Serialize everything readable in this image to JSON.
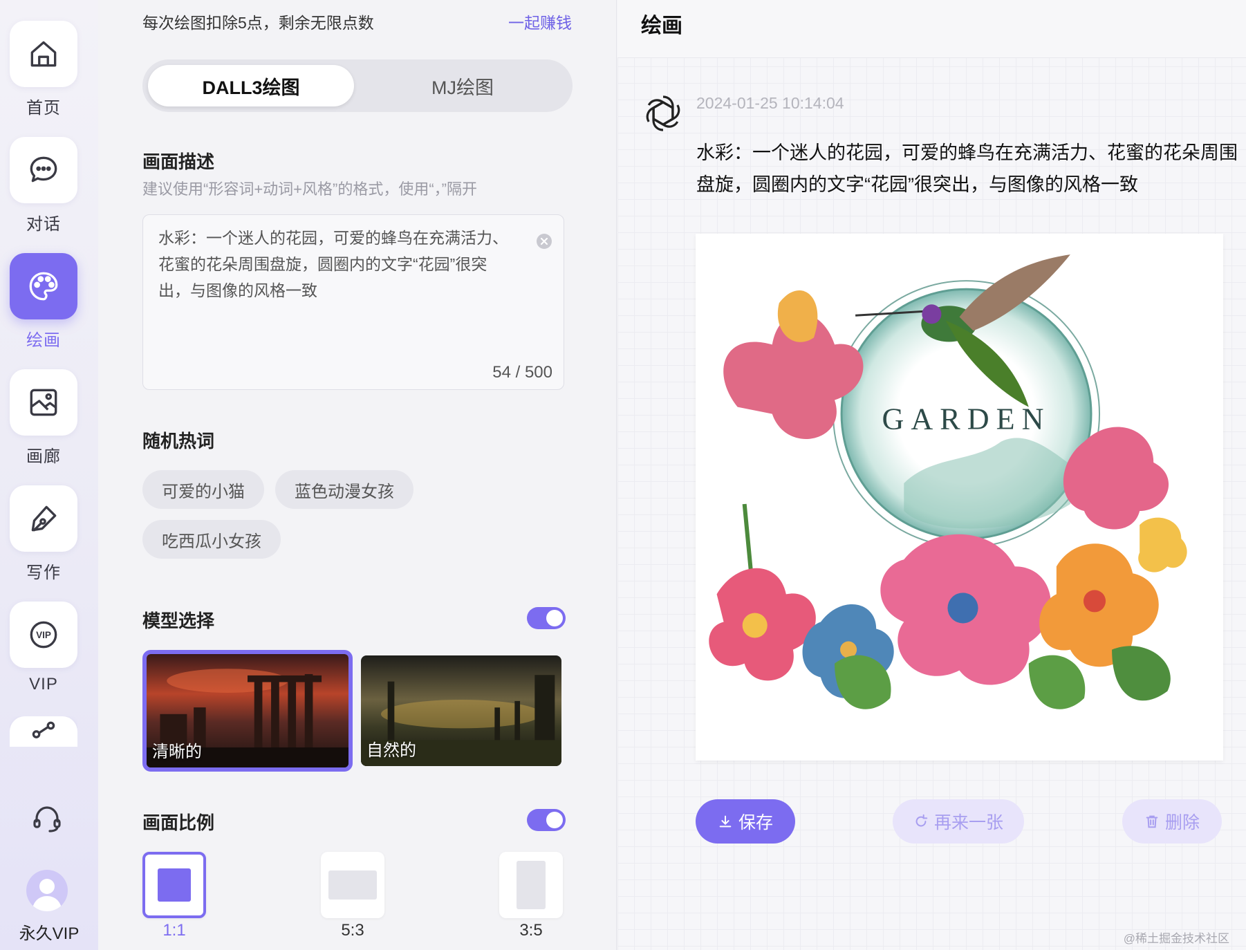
{
  "nav": {
    "items": [
      {
        "label": "首页",
        "icon": "home-icon"
      },
      {
        "label": "对话",
        "icon": "chat-icon"
      },
      {
        "label": "绘画",
        "icon": "palette-icon"
      },
      {
        "label": "画廊",
        "icon": "gallery-icon"
      },
      {
        "label": "写作",
        "icon": "pen-icon"
      },
      {
        "label": "VIP",
        "icon": "vip-icon"
      }
    ],
    "active": "绘画",
    "user_label": "永久VIP"
  },
  "panel": {
    "points_text": "每次绘图扣除5点，剩余无限点数",
    "earn_link": "一起赚钱",
    "tabs": [
      "DALL3绘图",
      "MJ绘图"
    ],
    "active_tab": "DALL3绘图",
    "description": {
      "title": "画面描述",
      "hint": "建议使用“形容词+动词+风格”的格式，使用“，”隔开",
      "value": "水彩：一个迷人的花园，可爱的蜂鸟在充满活力、花蜜的花朵周围盘旋，圆圈内的文字“花园”很突出，与图像的风格一致",
      "count": "54 / 500"
    },
    "hot_words": {
      "title": "随机热词",
      "chips": [
        "可爱的小猫",
        "蓝色动漫女孩",
        "吃西瓜小女孩"
      ]
    },
    "model": {
      "title": "模型选择",
      "toggle_on": true,
      "options": [
        "清晰的",
        "自然的"
      ],
      "selected": "清晰的"
    },
    "ratio": {
      "title": "画面比例",
      "toggle_on": true,
      "options": [
        "1:1",
        "5:3",
        "3:5"
      ],
      "selected": "1:1"
    }
  },
  "result": {
    "title": "绘画",
    "timestamp": "2024-01-25 10:14:04",
    "prompt": "水彩：一个迷人的花园，可爱的蜂鸟在充满活力、花蜜的花朵周围盘旋，圆圈内的文字“花园”很突出，与图像的风格一致",
    "image_text": "GARDEN",
    "actions": {
      "save": "保存",
      "redo": "再来一张",
      "delete": "删除"
    },
    "watermark": "@稀土掘金技术社区"
  },
  "colors": {
    "accent": "#7c6cf0",
    "accent_light": "#e8e4fb",
    "link": "#6e61e6"
  }
}
